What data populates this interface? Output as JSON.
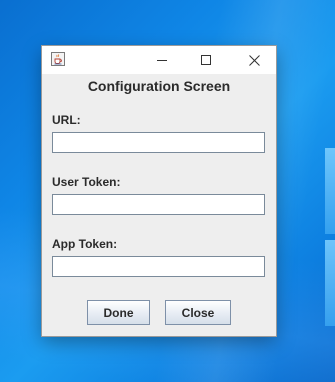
{
  "window": {
    "title_text": "Configuration Screen"
  },
  "titlebar": {
    "app_icon": "java-cup-icon",
    "minimize_icon": "minimize-icon",
    "maximize_icon": "maximize-icon",
    "close_icon": "close-icon"
  },
  "form": {
    "fields": [
      {
        "label": "URL:",
        "value": "",
        "placeholder": ""
      },
      {
        "label": "User Token:",
        "value": "",
        "placeholder": ""
      },
      {
        "label": "App Token:",
        "value": "",
        "placeholder": ""
      }
    ]
  },
  "buttons": {
    "done_label": "Done",
    "close_label": "Close"
  },
  "colors": {
    "desktop_blue": "#0f86e6",
    "window_bg": "#eeeeee",
    "titlebar_bg": "#ffffff"
  }
}
